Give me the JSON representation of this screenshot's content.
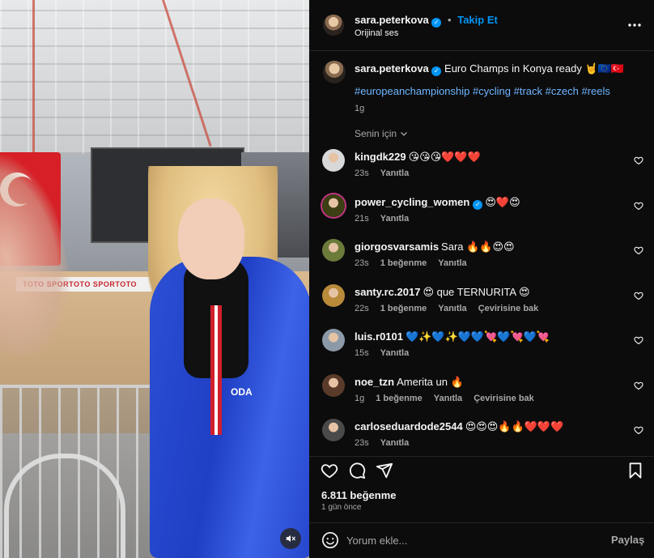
{
  "media": {
    "adboard_text": "TOTO   SPORTOTO   SPORTOTO",
    "suit_text": "ODA"
  },
  "header": {
    "username": "sara.peterkova",
    "follow_label": "Takip Et",
    "audio_label": "Orijinal ses"
  },
  "caption": {
    "username": "sara.peterkova",
    "text": "Euro Champs in Konya ready 🤘🇪🇺🇹🇷",
    "hashtags": [
      "#europeanchampionship",
      "#cycling",
      "#track",
      "#czech",
      "#reels"
    ],
    "time": "1g"
  },
  "filter_label": "Senin için",
  "comments": [
    {
      "username": "kingdk229",
      "text": "😘😘😘❤️❤️❤️",
      "time": "23s",
      "likes": "",
      "reply": "Yanıtla",
      "translate": "",
      "avatar_color": "#d8d8d8"
    },
    {
      "username": "power_cycling_women",
      "verified": true,
      "text": "😍❤️😍",
      "time": "21s",
      "likes": "",
      "reply": "Yanıtla",
      "translate": "",
      "avatar_color": "#3b3f12"
    },
    {
      "username": "giorgosvarsamis",
      "text": "Sara 🔥🔥😍😍",
      "time": "23s",
      "likes": "1 beğenme",
      "reply": "Yanıtla",
      "translate": "",
      "avatar_color": "#6c7a3a"
    },
    {
      "username": "santy.rc.2017",
      "text": "😍 que TERNURITA 😍",
      "time": "22s",
      "likes": "1 beğenme",
      "reply": "Yanıtla",
      "translate": "Çevirisine bak",
      "avatar_color": "#b88a3a"
    },
    {
      "username": "luis.r0101",
      "text": "💙✨💙✨💙💙💘💙💘💙💘",
      "time": "15s",
      "likes": "",
      "reply": "Yanıtla",
      "translate": "",
      "avatar_color": "#8c9aa8"
    },
    {
      "username": "noe_tzn",
      "text": "Amerita un 🔥",
      "time": "1g",
      "likes": "1 beğenme",
      "reply": "Yanıtla",
      "translate": "Çevirisine bak",
      "avatar_color": "#5a3b2a"
    },
    {
      "username": "carloseduardode2544",
      "text": "😍😍😍🔥🔥❤️❤️❤️",
      "time": "23s",
      "likes": "",
      "reply": "Yanıtla",
      "translate": "",
      "avatar_color": "#4a4a4a"
    }
  ],
  "actions": {
    "likes_count": "6.811 beğenme",
    "posted_ago": "1 gün önce"
  },
  "composer": {
    "placeholder": "Yorum ekle...",
    "share_label": "Paylaş"
  },
  "colors": {
    "accent": "#0095f6",
    "hashtag": "#6fb6ff",
    "background": "#0c0c0c",
    "secondary_text": "#a8a8a8"
  },
  "icons": [
    "verified-badge-icon",
    "more-options-icon",
    "chevron-down-icon",
    "heart-icon",
    "comment-icon",
    "share-icon",
    "bookmark-icon",
    "emoji-icon",
    "muted-speaker-icon"
  ]
}
